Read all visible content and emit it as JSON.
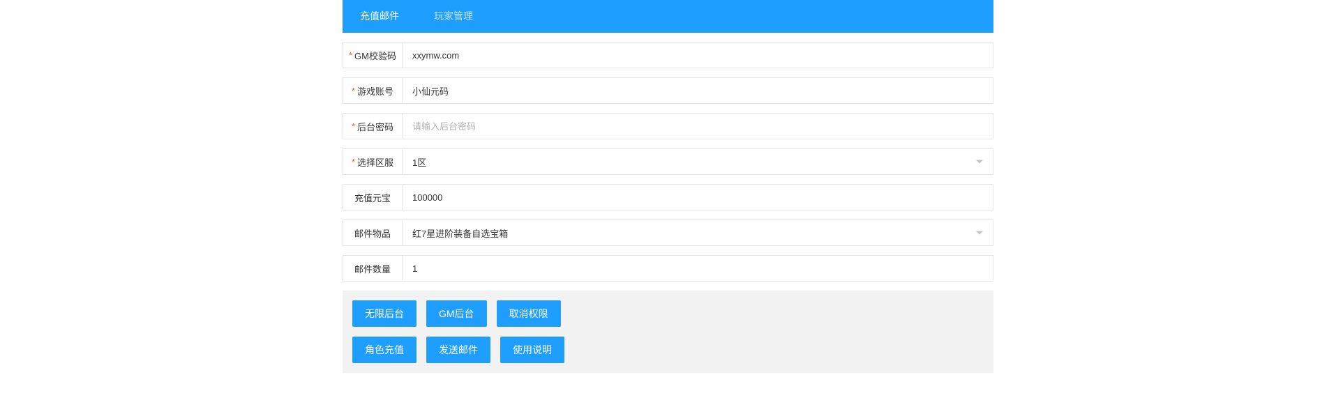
{
  "tabs": [
    {
      "label": "充值邮件"
    },
    {
      "label": "玩家管理"
    }
  ],
  "form": {
    "gm_code": {
      "label": "GM校验码",
      "value": "xxymw.com",
      "required": true
    },
    "account": {
      "label": "游戏账号",
      "value": "小仙元码",
      "required": true
    },
    "password": {
      "label": "后台密码",
      "value": "",
      "placeholder": "请输入后台密码",
      "required": true
    },
    "server": {
      "label": "选择区服",
      "value": "1区",
      "required": true
    },
    "yuanbao": {
      "label": "充值元宝",
      "value": "100000",
      "required": false
    },
    "item": {
      "label": "邮件物品",
      "value": "红7星进阶装备自选宝箱",
      "required": false
    },
    "quantity": {
      "label": "邮件数量",
      "value": "1",
      "required": false
    }
  },
  "buttons": {
    "unlimited_backend": "无限后台",
    "gm_backend": "GM后台",
    "cancel_permission": "取消权限",
    "role_recharge": "角色充值",
    "send_mail": "发送邮件",
    "usage_instructions": "使用说明"
  }
}
